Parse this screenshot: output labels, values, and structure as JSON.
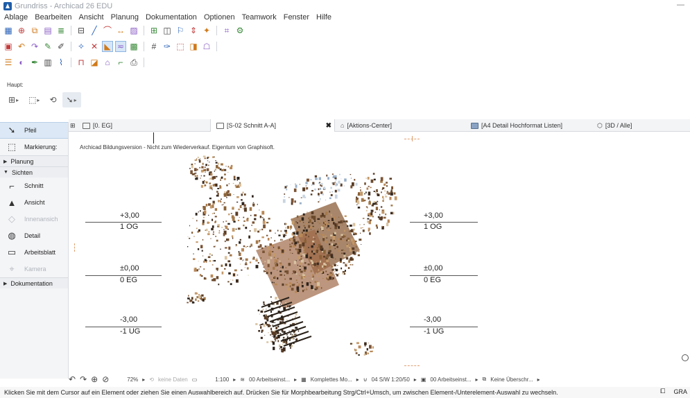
{
  "window": {
    "title": "Grundriss - Archicad 26 EDU"
  },
  "menu": [
    "Ablage",
    "Bearbeiten",
    "Ansicht",
    "Planung",
    "Dokumentation",
    "Optionen",
    "Teamwork",
    "Fenster",
    "Hilfe"
  ],
  "toolbar_icons": {
    "row1": [
      "layout-grid-icon",
      "zoom-icon",
      "arrange-icon",
      "wall-icon",
      "stair-icon",
      "window-icon",
      "line-icon",
      "arc-icon",
      "dimension-icon",
      "fill-icon",
      "floor-icon",
      "view-icon",
      "teamwork-icon",
      "push-pull-icon",
      "renovation-icon",
      "snap-icon",
      "settings-icon"
    ],
    "row2": [
      "save-icon",
      "undo-icon",
      "redo-icon",
      "pick-icon",
      "pen-icon",
      "magic-wand-icon",
      "delete-icon",
      "arrow-icon",
      "line-style-icon",
      "fill-pattern-icon",
      "grid-icon",
      "brush-icon",
      "marquee-icon",
      "trace-icon",
      "stamp-icon"
    ],
    "row3": [
      "layers-icon",
      "graphic-override-icon",
      "pen-set-icon",
      "model-view-icon",
      "renovation-filter-icon",
      "structure-icon",
      "partial-display-icon",
      "story-icon",
      "section-icon",
      "publisher-icon"
    ]
  },
  "haupt": {
    "label": "Haupt:"
  },
  "toolbox": {
    "tools_top": [
      {
        "label": "Pfeil",
        "icon": "arrow-pointer-icon",
        "active": true
      },
      {
        "label": "Markierung:",
        "icon": "marquee-icon",
        "active": false
      }
    ],
    "sections": {
      "planung": "Planung",
      "sichten": "Sichten",
      "dokumentation": "Dokumentation"
    },
    "sichten_tools": [
      {
        "label": "Schnitt",
        "icon": "section-marker-icon",
        "dim": false
      },
      {
        "label": "Ansicht",
        "icon": "elevation-marker-icon",
        "dim": false
      },
      {
        "label": "Innenansich",
        "icon": "interior-elevation-icon",
        "dim": true
      },
      {
        "label": "Detail",
        "icon": "detail-marker-icon",
        "dim": false
      },
      {
        "label": "Arbeitsblatt",
        "icon": "worksheet-icon",
        "dim": false
      },
      {
        "label": "Kamera",
        "icon": "camera-icon",
        "dim": true
      }
    ]
  },
  "tabs": [
    {
      "label": "[0. EG]",
      "icon": "floor-plan-icon"
    },
    {
      "label": "[S-02 Schnitt A-A]",
      "icon": "section-tab-icon"
    },
    {
      "label": "[Aktions-Center]",
      "icon": "action-center-icon"
    },
    {
      "label": "[A4 Detail Hochformat Listen]",
      "icon": "layout-tab-icon"
    },
    {
      "label": "[3D / Alle]",
      "icon": "cube-icon"
    }
  ],
  "viewport": {
    "edu_note": "Archicad Bildungsversion - Nicht zum Wiederverkauf. Eigentum von Graphisoft.",
    "levels_left": [
      {
        "value": "+3,00",
        "name": "1 OG"
      },
      {
        "value": "±0,00",
        "name": "0 EG"
      },
      {
        "value": "-3,00",
        "name": "-1 UG"
      }
    ],
    "levels_right": [
      {
        "value": "+3,00",
        "name": "1 OG"
      },
      {
        "value": "±0,00",
        "name": "0 EG"
      },
      {
        "value": "-3,00",
        "name": "-1 UG"
      }
    ]
  },
  "statusbar": {
    "zoom": "72%",
    "keine_daten": "keine Daten",
    "scale": "1:100",
    "layer_combo": "00 Arbeitseinst...",
    "model_view": "Komplettes Mo...",
    "pen_set": "04 S/W 1:20/50",
    "graphic_override": "00 Arbeitseinst...",
    "renovation": "Keine Überschr..."
  },
  "hint": "Klicken Sie mit dem Cursor auf ein Element oder ziehen Sie einen Auswahlbereich auf. Drücken Sie für Morphbearbeitung Strg/Ctrl+Umsch, um zwischen Element-/Unterelement-Auswahl zu wechseln.",
  "hint_right": "GRA"
}
